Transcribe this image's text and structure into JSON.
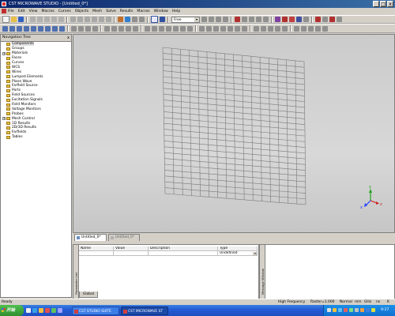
{
  "window": {
    "title": "CST MICROWAVE STUDIO - [Untitled_0*]",
    "buttons": [
      "_",
      "□",
      "x"
    ]
  },
  "menu": [
    "File",
    "Edit",
    "View",
    "Macros",
    "Curves",
    "Objects",
    "Mesh",
    "Solve",
    "Results",
    "Macros",
    "Window",
    "Help"
  ],
  "toolbar": {
    "combo_value": "Free",
    "combo_icon": "chevron-down-icon"
  },
  "nav": {
    "title": "Navigation Tree",
    "close": "x",
    "items": [
      {
        "label": "Components",
        "expand": "",
        "selected": true
      },
      {
        "label": "Groups",
        "expand": ""
      },
      {
        "label": "Materials",
        "expand": "+"
      },
      {
        "label": "Faces",
        "expand": ""
      },
      {
        "label": "Curves",
        "expand": ""
      },
      {
        "label": "WCS",
        "expand": ""
      },
      {
        "label": "Wires",
        "expand": ""
      },
      {
        "label": "Lumped Elements",
        "expand": ""
      },
      {
        "label": "Plane Wave",
        "expand": ""
      },
      {
        "label": "Farfield Source",
        "expand": ""
      },
      {
        "label": "Ports",
        "expand": ""
      },
      {
        "label": "Field Sources",
        "expand": ""
      },
      {
        "label": "Excitation Signals",
        "expand": ""
      },
      {
        "label": "Field Monitors",
        "expand": ""
      },
      {
        "label": "Voltage Monitors",
        "expand": ""
      },
      {
        "label": "Probes",
        "expand": ""
      },
      {
        "label": "Mesh Control",
        "expand": "+"
      },
      {
        "label": "1D Results",
        "expand": ""
      },
      {
        "label": "2D/3D Results",
        "expand": ""
      },
      {
        "label": "Farfields",
        "expand": ""
      },
      {
        "label": "Tables",
        "expand": ""
      }
    ]
  },
  "axes": {
    "x": "x",
    "y": "y",
    "z": "z"
  },
  "tabs": [
    "Untitled_0*",
    "Untitled_0*"
  ],
  "params": {
    "headers": [
      "Name",
      "Value",
      "Description",
      "Type"
    ],
    "row": [
      "",
      "",
      "",
      "Undefined"
    ],
    "global_tab": "Global",
    "side_label": "Parameter List"
  },
  "messages": {
    "side_label": "Message Window"
  },
  "status": {
    "left": "Ready",
    "items": [
      "High Frequency",
      "Raster=1.000",
      "Normal",
      "mm",
      "GHz",
      "ns",
      "K"
    ]
  },
  "taskbar": {
    "start": "开始",
    "tasks": [
      "CST STUDIO SUITE",
      "CST MICROWAVE ST"
    ],
    "clock": "9:27"
  },
  "colors": {
    "title_start": "#0a246a",
    "title_end": "#3a6ea5",
    "grid_line": "#7a7a7a",
    "axis_x": "#2040ff",
    "axis_y": "#20a020",
    "axis_z": "#d02020"
  }
}
